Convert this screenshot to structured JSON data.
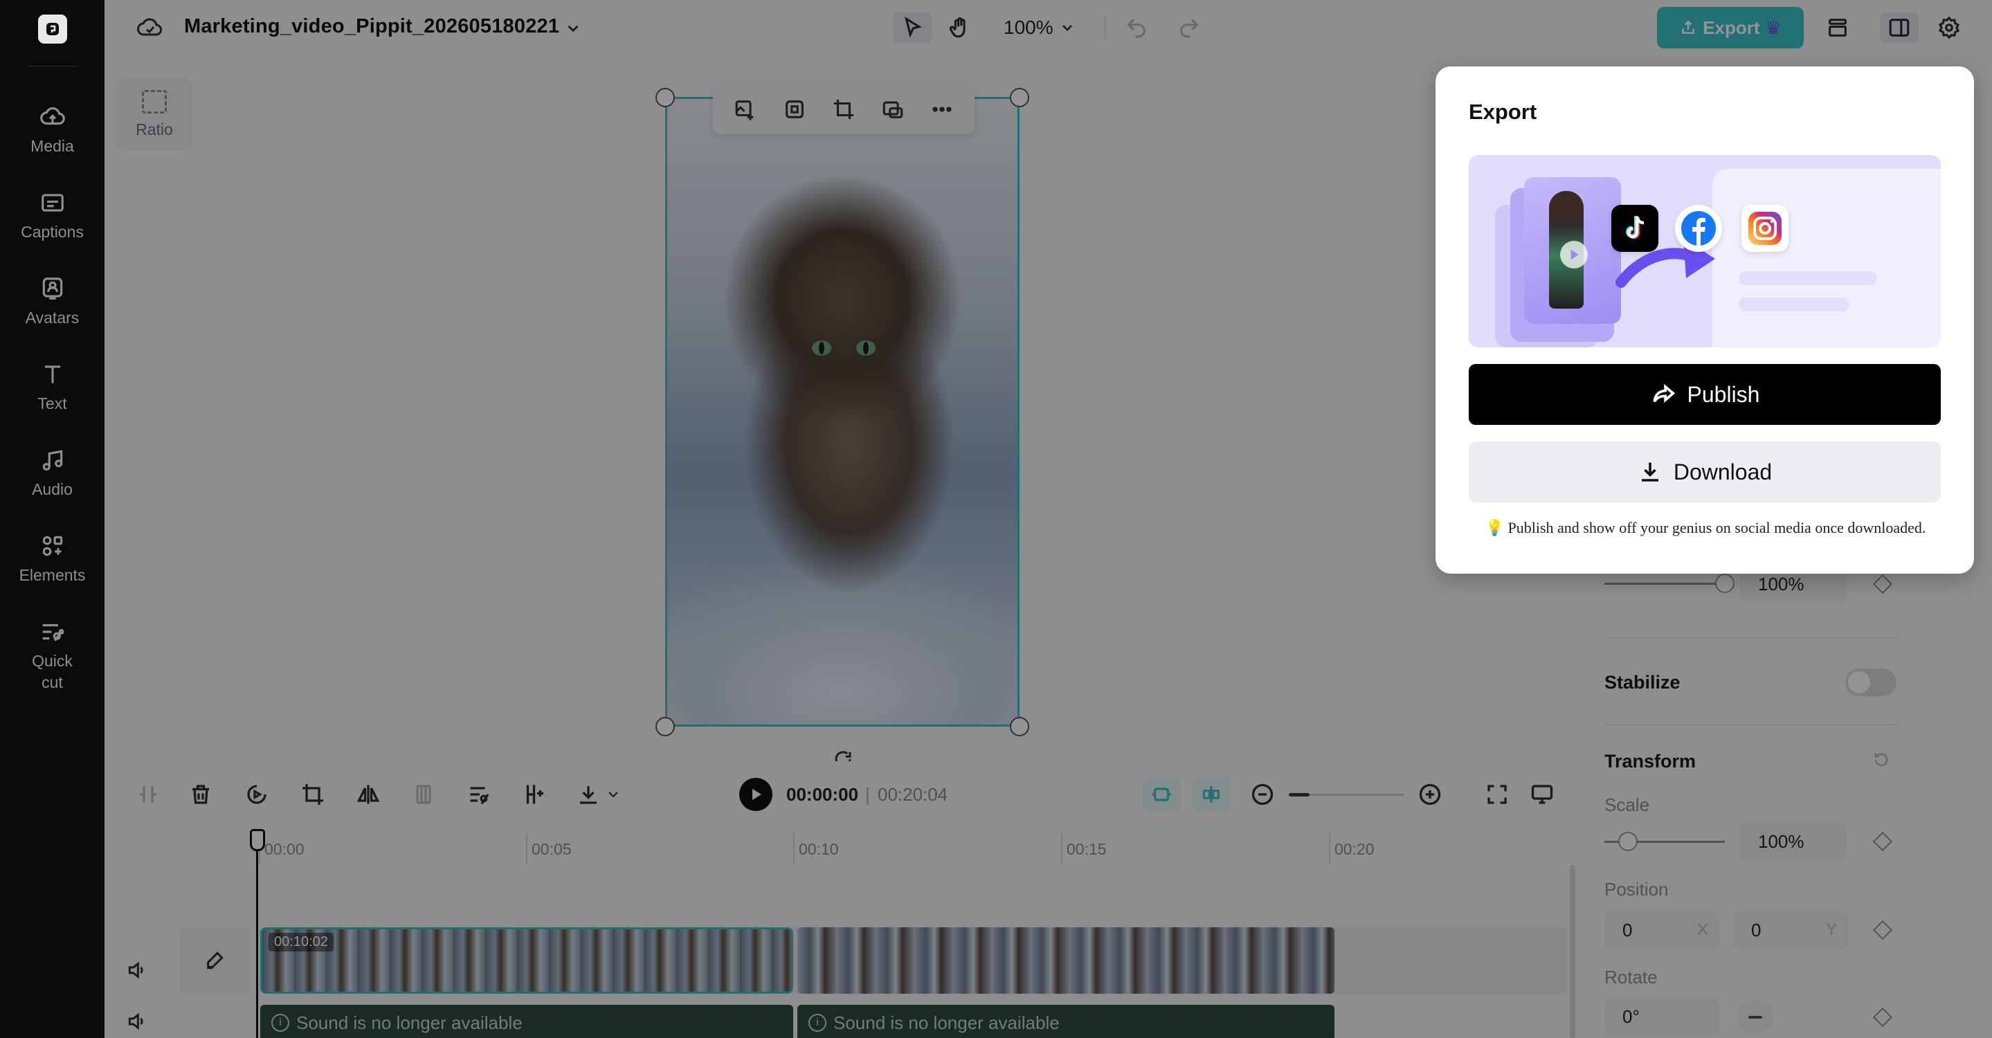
{
  "project": {
    "title": "Marketing_video_Pippit_202605180221"
  },
  "toolbar": {
    "zoom": "100%",
    "export_label": "Export"
  },
  "rail": {
    "items": [
      {
        "label": "Media",
        "icon": "cloud-upload-icon"
      },
      {
        "label": "Captions",
        "icon": "captions-icon"
      },
      {
        "label": "Avatars",
        "icon": "avatar-icon"
      },
      {
        "label": "Text",
        "icon": "text-icon"
      },
      {
        "label": "Audio",
        "icon": "music-note-icon"
      },
      {
        "label": "Elements",
        "icon": "elements-icon"
      },
      {
        "label": "Quick\ncut",
        "icon": "quick-cut-icon"
      }
    ]
  },
  "canvas": {
    "ratio_label": "Ratio"
  },
  "timeline": {
    "current_time": "00:00:00",
    "separator": "|",
    "total_time": "00:20:04",
    "ruler_labels": [
      "00:00",
      "00:05",
      "00:10",
      "00:15",
      "00:20"
    ],
    "clip1_duration": "00:10:02",
    "audio_clips": [
      "Sound is no longer available",
      "Sound is no longer available"
    ]
  },
  "properties": {
    "opacity_value": "100%",
    "stabilize_label": "Stabilize",
    "transform_label": "Transform",
    "scale_label": "Scale",
    "scale_value": "100%",
    "position_label": "Position",
    "position_x": "0",
    "position_x_axis": "X",
    "position_y": "0",
    "position_y_axis": "Y",
    "rotate_label": "Rotate",
    "rotate_value": "0°"
  },
  "export_modal": {
    "title": "Export",
    "publish_label": "Publish",
    "download_label": "Download",
    "tip": "💡 Publish and show off your genius on social media once downloaded."
  },
  "colors": {
    "accent": "#3cc2c9",
    "rail_bg": "#0b0b0b",
    "audio_clip": "#2c4a3e",
    "banner_bg": "#e2ddfc"
  }
}
